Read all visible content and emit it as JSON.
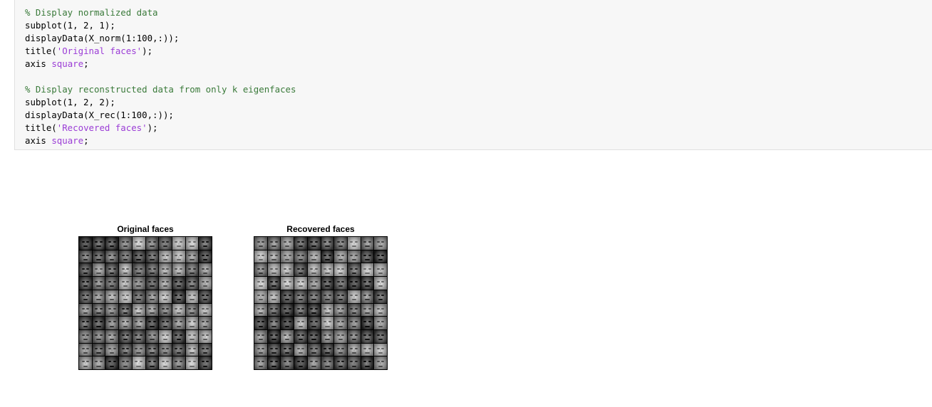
{
  "code_cell": {
    "lines": [
      {
        "type": "comment",
        "text": "% Display normalized data"
      },
      {
        "type": "code",
        "parts": [
          {
            "t": "plain",
            "v": "subplot(1, 2, 1);"
          }
        ]
      },
      {
        "type": "code",
        "parts": [
          {
            "t": "plain",
            "v": "displayData(X_norm(1:100,:));"
          }
        ]
      },
      {
        "type": "code",
        "parts": [
          {
            "t": "plain",
            "v": "title("
          },
          {
            "t": "string",
            "v": "'Original faces'"
          },
          {
            "t": "plain",
            "v": ");"
          }
        ]
      },
      {
        "type": "code",
        "parts": [
          {
            "t": "plain",
            "v": "axis "
          },
          {
            "t": "keyword",
            "v": "square"
          },
          {
            "t": "plain",
            "v": ";"
          }
        ]
      },
      {
        "type": "blank"
      },
      {
        "type": "comment",
        "text": "% Display reconstructed data from only k eigenfaces"
      },
      {
        "type": "code",
        "parts": [
          {
            "t": "plain",
            "v": "subplot(1, 2, 2);"
          }
        ]
      },
      {
        "type": "code",
        "parts": [
          {
            "t": "plain",
            "v": "displayData(X_rec(1:100,:));"
          }
        ]
      },
      {
        "type": "code",
        "parts": [
          {
            "t": "plain",
            "v": "title("
          },
          {
            "t": "string",
            "v": "'Recovered faces'"
          },
          {
            "t": "plain",
            "v": ");"
          }
        ]
      },
      {
        "type": "code",
        "parts": [
          {
            "t": "plain",
            "v": "axis "
          },
          {
            "t": "keyword",
            "v": "square"
          },
          {
            "t": "plain",
            "v": ";"
          }
        ]
      }
    ]
  },
  "output": {
    "subplots": [
      {
        "title": "Original faces",
        "grid_rows": 10,
        "grid_cols": 10
      },
      {
        "title": "Recovered faces",
        "grid_rows": 10,
        "grid_cols": 10
      }
    ]
  },
  "colors": {
    "comment": "#3a7a3a",
    "string": "#9b3dd6",
    "keyword": "#9b3dd6",
    "cell_background": "#f7f7f7"
  }
}
